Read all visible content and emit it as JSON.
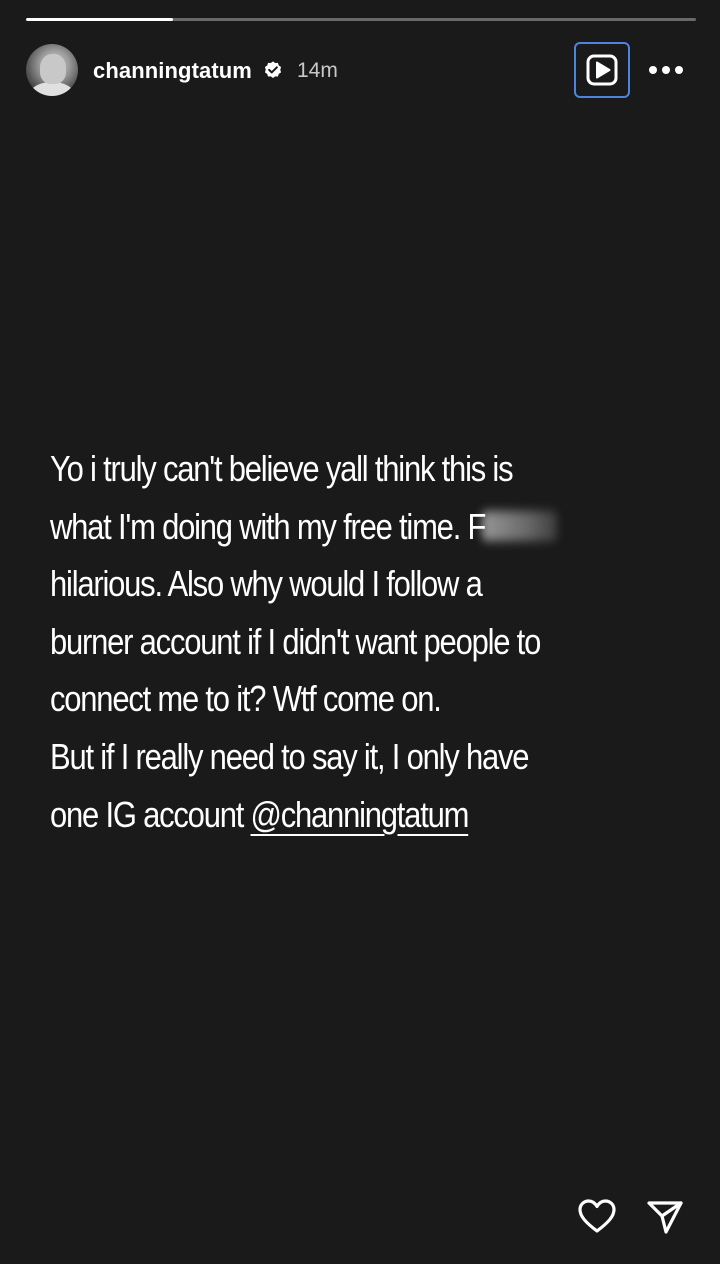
{
  "progress": 0.22,
  "header": {
    "username": "channingtatum",
    "timestamp": "14m",
    "verified": true,
    "icons": {
      "verified": "verified-badge-icon",
      "play": "play-icon",
      "more": "more-options-icon"
    }
  },
  "story": {
    "lines": [
      "Yo i truly can't believe yall think this is",
      "what I'm doing with my free time. F",
      "hilarious. Also why would I follow a",
      "burner account if I didn't want people to",
      "connect me to it? Wtf come on.",
      "But if I really need to say it, I only have",
      "one IG account "
    ],
    "mention": "@channingtatum"
  },
  "footer": {
    "icons": {
      "like": "heart-icon",
      "share": "send-icon"
    }
  },
  "colors": {
    "background": "#1a1a1a",
    "text": "#ffffff",
    "focus_ring": "#4c84e0"
  }
}
